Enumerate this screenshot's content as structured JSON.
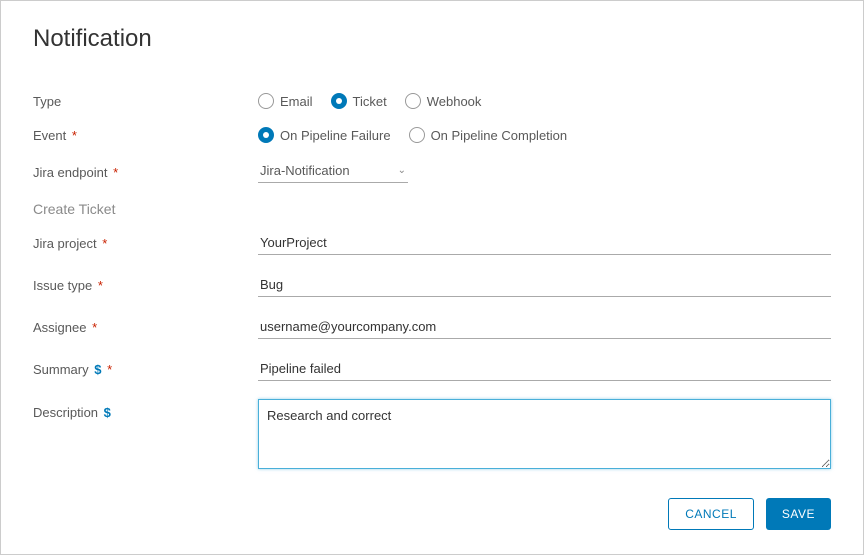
{
  "title": "Notification",
  "form": {
    "type": {
      "label": "Type",
      "options": {
        "email": "Email",
        "ticket": "Ticket",
        "webhook": "Webhook"
      }
    },
    "event": {
      "label": "Event",
      "options": {
        "failure": "On Pipeline Failure",
        "completion": "On Pipeline Completion"
      }
    },
    "jira_endpoint": {
      "label": "Jira endpoint",
      "value": "Jira-Notification"
    },
    "section_header": "Create Ticket",
    "jira_project": {
      "label": "Jira project",
      "value": "YourProject"
    },
    "issue_type": {
      "label": "Issue type",
      "value": "Bug"
    },
    "assignee": {
      "label": "Assignee",
      "value": "username@yourcompany.com"
    },
    "summary": {
      "label": "Summary",
      "value": "Pipeline failed"
    },
    "description": {
      "label": "Description",
      "value": "Research and correct"
    }
  },
  "buttons": {
    "cancel": "CANCEL",
    "save": "SAVE"
  },
  "symbols": {
    "required": "*",
    "variable": "$"
  }
}
